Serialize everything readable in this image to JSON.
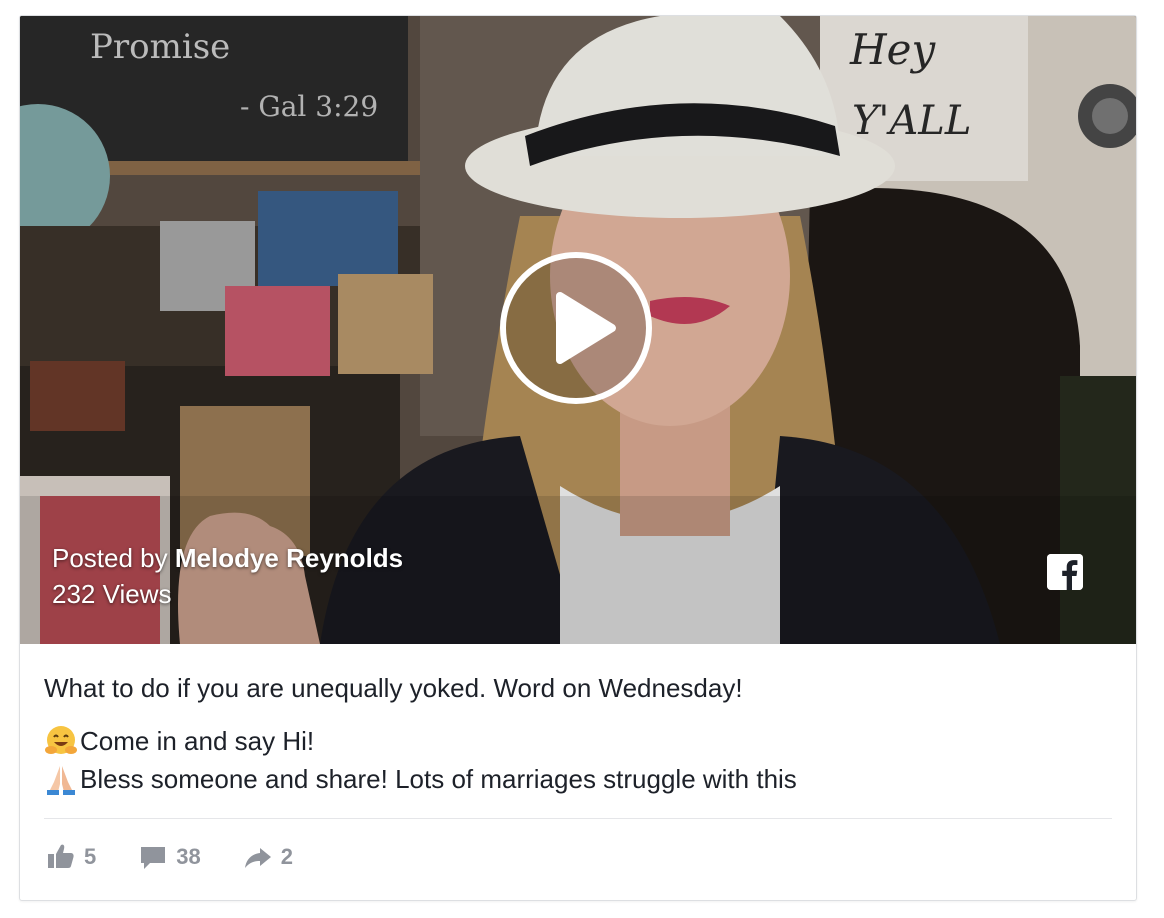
{
  "video": {
    "posted_by_prefix": "Posted by ",
    "author": "Melodye Reynolds",
    "views": "232 Views",
    "play_icon": "play-icon",
    "brand_icon": "facebook-icon",
    "chalkboard_text_1": "Promise",
    "chalkboard_text_2": "- Gal 3:29",
    "sign_text_1": "Hey",
    "sign_text_2": "Y'ALL"
  },
  "post": {
    "title": "What to do if you are unequally yoked. Word on Wednesday!",
    "lines": [
      {
        "emoji": "hugging-face-emoji",
        "text": "Come in and say Hi!"
      },
      {
        "emoji": "folded-hands-emoji",
        "text": "Bless someone and share! Lots of marriages struggle with this"
      }
    ]
  },
  "actions": {
    "likes": "5",
    "comments": "38",
    "shares": "2"
  },
  "colors": {
    "text": "#1d2129",
    "muted": "#90949c",
    "border": "#dddfe2",
    "white": "#ffffff"
  }
}
